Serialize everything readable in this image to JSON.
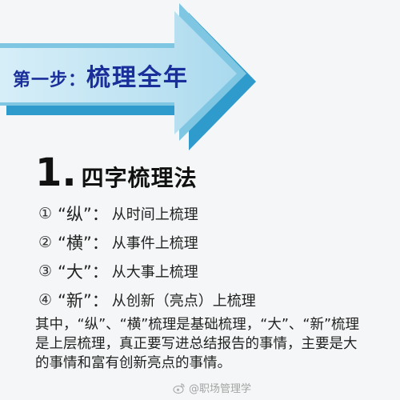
{
  "banner": {
    "step_prefix": "第一步：",
    "step_title": "梳理全年"
  },
  "section": {
    "number": "1.",
    "title": "四字梳理法"
  },
  "methods": [
    {
      "index": "①",
      "keyword": "“纵”：",
      "description": "从时间上梳理"
    },
    {
      "index": "②",
      "keyword": "“横”：",
      "description": "从事件上梳理"
    },
    {
      "index": "③",
      "keyword": "“大”：",
      "description": "从大事上梳理"
    },
    {
      "index": "④",
      "keyword": "“新”：",
      "description": "从创新（亮点）上梳理"
    }
  ],
  "summary": "其中，“纵”、“横”梳理是基础梳理，“大”、“新”梳理是上层梳理，真正要写进总结报告的事情，主要是大的事情和富有创新亮点的事情。",
  "watermark": {
    "text": "@职场管理学",
    "icon": "weibo-icon"
  },
  "colors": {
    "background": "#f4f6f7",
    "arrow_light": "#c9e7f4",
    "arrow_mid": "#8fcde6",
    "arrow_dark": "#3fa9d6",
    "title_blue": "#1b2f9a"
  }
}
